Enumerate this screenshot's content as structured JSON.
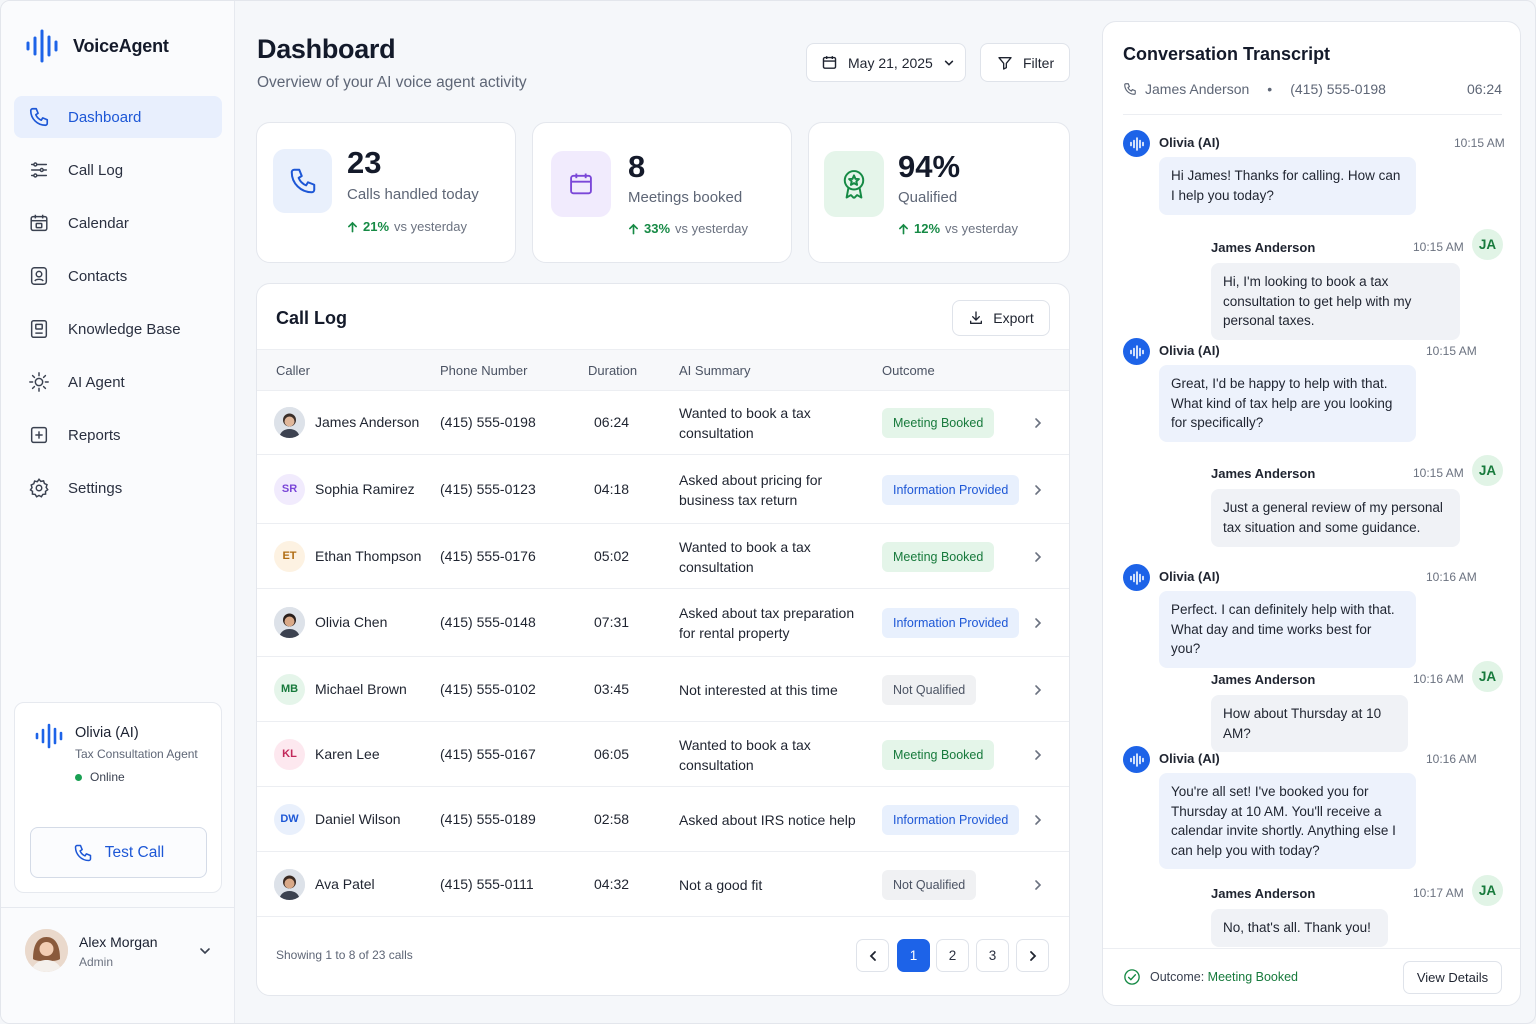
{
  "app": {
    "name": "VoiceAgent"
  },
  "nav": [
    {
      "label": "Dashboard",
      "icon": "phone-icon",
      "active": true
    },
    {
      "label": "Call Log",
      "icon": "list-icon"
    },
    {
      "label": "Calendar",
      "icon": "calendar-icon"
    },
    {
      "label": "Contacts",
      "icon": "contact-icon"
    },
    {
      "label": "Knowledge Base",
      "icon": "book-icon"
    },
    {
      "label": "AI Agent",
      "icon": "agent-icon"
    },
    {
      "label": "Reports",
      "icon": "report-icon"
    },
    {
      "label": "Settings",
      "icon": "gear-icon"
    }
  ],
  "agent": {
    "name": "Olivia (AI)",
    "role": "Tax Consultation Agent",
    "status": "Online",
    "test_call_label": "Test Call"
  },
  "user": {
    "name": "Alex Morgan",
    "role": "Admin"
  },
  "header": {
    "title": "Dashboard",
    "subtitle": "Overview of your AI voice agent activity",
    "date": "May 21, 2025",
    "filter_label": "Filter"
  },
  "stats": [
    {
      "value": "23",
      "label": "Calls handled today",
      "delta": "21%",
      "delta_suffix": "vs yesterday"
    },
    {
      "value": "8",
      "label": "Meetings booked",
      "delta": "33%",
      "delta_suffix": "vs yesterday"
    },
    {
      "value": "94%",
      "label": "Qualified",
      "delta": "12%",
      "delta_suffix": "vs yesterday"
    }
  ],
  "calllog": {
    "title": "Call Log",
    "export_label": "Export",
    "columns": [
      "Caller",
      "Phone Number",
      "Duration",
      "AI Summary",
      "Outcome"
    ],
    "rows": [
      {
        "name": "James Anderson",
        "initials": "",
        "phone": "(415) 555-0198",
        "duration": "06:24",
        "summary": "Wanted to book a tax consultation",
        "outcome": "Meeting Booked"
      },
      {
        "name": "Sophia Ramirez",
        "initials": "SR",
        "phone": "(415) 555-0123",
        "duration": "04:18",
        "summary": "Asked about pricing for business tax return",
        "outcome": "Information Provided"
      },
      {
        "name": "Ethan Thompson",
        "initials": "ET",
        "phone": "(415) 555-0176",
        "duration": "05:02",
        "summary": "Wanted to book a tax consultation",
        "outcome": "Meeting Booked"
      },
      {
        "name": "Olivia Chen",
        "initials": "",
        "phone": "(415) 555-0148",
        "duration": "07:31",
        "summary": "Asked about tax preparation for rental property",
        "outcome": "Information Provided"
      },
      {
        "name": "Michael Brown",
        "initials": "MB",
        "phone": "(415) 555-0102",
        "duration": "03:45",
        "summary": "Not interested at this time",
        "outcome": "Not Qualified"
      },
      {
        "name": "Karen Lee",
        "initials": "KL",
        "phone": "(415) 555-0167",
        "duration": "06:05",
        "summary": "Wanted to book a tax consultation",
        "outcome": "Meeting Booked"
      },
      {
        "name": "Daniel Wilson",
        "initials": "DW",
        "phone": "(415) 555-0189",
        "duration": "02:58",
        "summary": "Asked about IRS notice help",
        "outcome": "Information Provided"
      },
      {
        "name": "Ava Patel",
        "initials": "",
        "phone": "(415) 555-0111",
        "duration": "04:32",
        "summary": "Not a good fit",
        "outcome": "Not Qualified"
      }
    ],
    "showing": "Showing 1 to 8 of 23 calls",
    "pages": [
      "1",
      "2",
      "3"
    ],
    "current_page": "1"
  },
  "transcript": {
    "title": "Conversation Transcript",
    "caller": "James Anderson",
    "phone": "(415) 555-0198",
    "duration": "06:24",
    "messages": [
      {
        "from": "ai",
        "name": "Olivia (AI)",
        "time": "10:15 AM",
        "text": "Hi James! Thanks for calling. How can I help you today?"
      },
      {
        "from": "user",
        "name": "James Anderson",
        "time": "10:15 AM",
        "text": "Hi, I'm looking to book a tax consultation to get help with my personal taxes.",
        "initials": "JA"
      },
      {
        "from": "ai",
        "name": "Olivia (AI)",
        "time": "10:15 AM",
        "text": "Great, I'd be happy to help with that. What kind of tax help are you looking for specifically?"
      },
      {
        "from": "user",
        "name": "James Anderson",
        "time": "10:15 AM",
        "text": "Just a general review of my personal tax situation and some guidance.",
        "initials": "JA"
      },
      {
        "from": "ai",
        "name": "Olivia (AI)",
        "time": "10:16 AM",
        "text": "Perfect. I can definitely help with that. What day and time works best for you?"
      },
      {
        "from": "user",
        "name": "James Anderson",
        "time": "10:16 AM",
        "text": "How about Thursday at 10 AM?",
        "initials": "JA"
      },
      {
        "from": "ai",
        "name": "Olivia (AI)",
        "time": "10:16 AM",
        "text": "You're all set! I've booked you for Thursday at 10 AM. You'll receive a calendar invite shortly. Anything else I can help you with today?"
      },
      {
        "from": "user",
        "name": "James Anderson",
        "time": "10:17 AM",
        "text": "No, that's all. Thank you!",
        "initials": "JA"
      }
    ],
    "outcome_label": "Outcome:",
    "outcome_value": "Meeting Booked",
    "view_details_label": "View Details"
  },
  "colors": {
    "accent": "#1d63e8",
    "success": "#177a3c"
  }
}
